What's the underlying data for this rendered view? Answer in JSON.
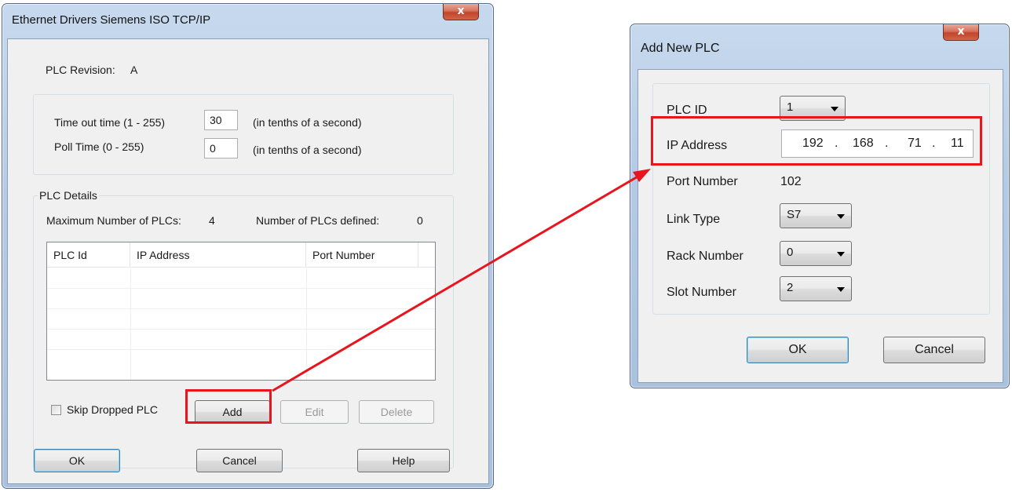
{
  "left_dialog": {
    "title": "Ethernet Drivers Siemens ISO TCP/IP",
    "close_glyph": "x",
    "plc_revision_label": "PLC Revision:",
    "plc_revision_value": "A",
    "timeout_label": "Time out time (1 - 255)",
    "timeout_value": "30",
    "timeout_unit": "(in tenths of a second)",
    "poll_label": "Poll Time (0 - 255)",
    "poll_value": "0",
    "poll_unit": "(in tenths of a second)",
    "plc_details_label": "PLC Details",
    "max_plcs_label": "Maximum Number of PLCs:",
    "max_plcs_value": "4",
    "num_defined_label": "Number of PLCs defined:",
    "num_defined_value": "0",
    "columns": [
      "PLC Id",
      "IP Address",
      "Port Number"
    ],
    "skip_dropped_label": "Skip Dropped PLC",
    "add_label": "Add",
    "edit_label": "Edit",
    "delete_label": "Delete",
    "ok_label": "OK",
    "cancel_label": "Cancel",
    "help_label": "Help"
  },
  "right_dialog": {
    "title": "Add New PLC",
    "close_glyph": "x",
    "plc_id_label": "PLC ID",
    "plc_id_value": "1",
    "ip_label": "IP Address",
    "ip_octets": [
      "192",
      "168",
      "71",
      "11"
    ],
    "ip_dot": ".",
    "port_label": "Port Number",
    "port_value": "102",
    "link_type_label": "Link Type",
    "link_type_value": "S7",
    "rack_label": "Rack Number",
    "rack_value": "0",
    "slot_label": "Slot Number",
    "slot_value": "2",
    "ok_label": "OK",
    "cancel_label": "Cancel"
  },
  "annotation": {
    "color": "#e8141e"
  }
}
